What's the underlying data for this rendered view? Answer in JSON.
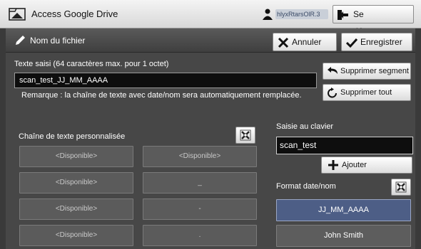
{
  "app": {
    "title": "Access Google Drive",
    "user_name": "hlyxRtarsOlR.3",
    "logout_label": "Se déconnecter"
  },
  "dialog": {
    "title": "Nom du fichier",
    "cancel_label": "Annuler",
    "save_label": "Enregistrer"
  },
  "entered": {
    "label": "Texte saisi (64 caractères max. pour 1 octet)",
    "value": "scan_test_JJ_MM_AAAA",
    "remark": "Remarque : la chaîne de texte avec date/nom sera automatiquement remplacée."
  },
  "side_buttons": {
    "delete_segment": "Supprimer segment",
    "delete_all": "Supprimer tout"
  },
  "custom": {
    "label": "Chaîne de texte personnalisée",
    "slots": [
      [
        "<Disponible>",
        "<Disponible>"
      ],
      [
        "<Disponible>",
        "_"
      ],
      [
        "<Disponible>",
        "-"
      ],
      [
        "<Disponible>",
        "."
      ]
    ]
  },
  "keyboard": {
    "label": "Saisie au clavier",
    "value": "scan_test",
    "add_label": "Ajouter"
  },
  "date_format": {
    "label": "Format date/nom",
    "options": [
      "JJ_MM_AAAA",
      "John Smith"
    ],
    "selected": "JJ_MM_AAAA"
  },
  "colors": {
    "selected_bg": "#4d5e86",
    "panel_bg": "#474747",
    "slot_bg": "#5b5b5b"
  },
  "icons": [
    "drive-icon",
    "user-icon",
    "logout-icon",
    "pencil-icon",
    "cancel-x-icon",
    "checkmark-icon",
    "undo-arrow-icon",
    "refresh-icon",
    "plus-icon",
    "tool-icon"
  ]
}
